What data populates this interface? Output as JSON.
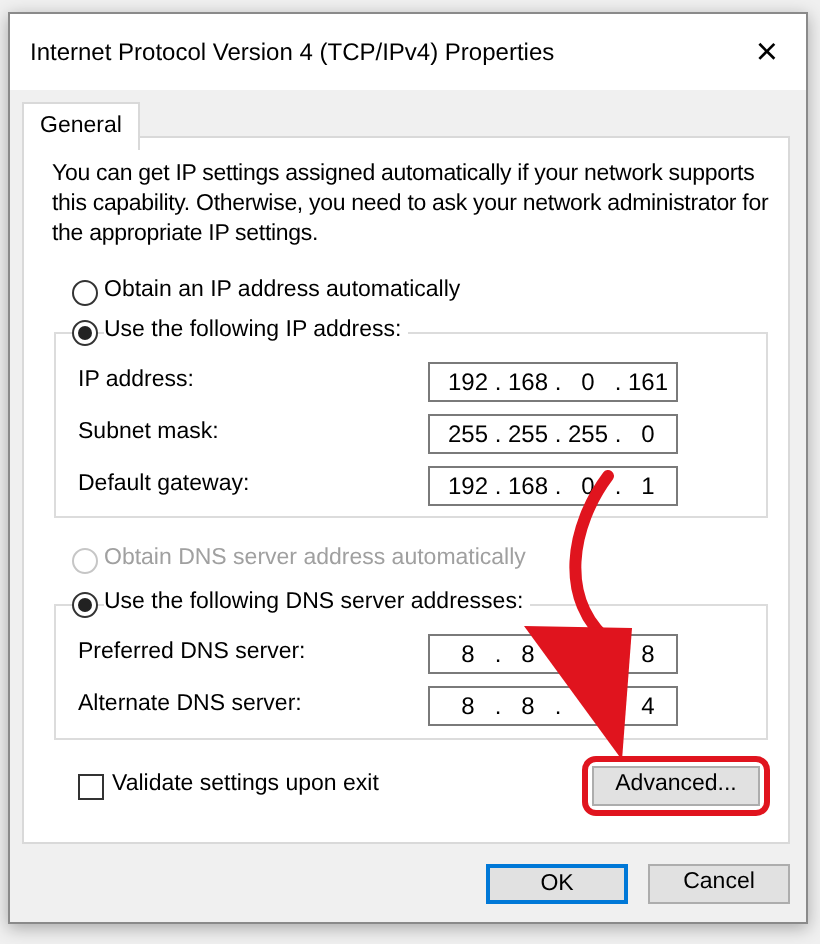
{
  "window": {
    "title": "Internet Protocol Version 4 (TCP/IPv4) Properties",
    "close": "×"
  },
  "tabs": [
    {
      "label": "General",
      "selected": true
    }
  ],
  "intro": "You can get IP settings assigned automatically if your network supports this capability. Otherwise, you need to ask your network administrator for the appropriate IP settings.",
  "ip_options": [
    {
      "label": "Obtain an IP address automatically",
      "selected": false,
      "disabled": false
    },
    {
      "label": "Use the following IP address:",
      "selected": true,
      "disabled": false
    }
  ],
  "octet_separator": ".",
  "ip_fields": [
    {
      "label": "IP address:",
      "octets": [
        "192",
        "168",
        "0",
        "161"
      ]
    },
    {
      "label": "Subnet mask:",
      "octets": [
        "255",
        "255",
        "255",
        "0"
      ]
    },
    {
      "label": "Default gateway:",
      "octets": [
        "192",
        "168",
        "0",
        "1"
      ]
    }
  ],
  "dns_options": [
    {
      "label": "Obtain DNS server address automatically",
      "selected": false,
      "disabled": true
    },
    {
      "label": "Use the following DNS server addresses:",
      "selected": true,
      "disabled": false
    }
  ],
  "dns_fields": [
    {
      "label": "Preferred DNS server:",
      "octets": [
        "8",
        "8"
      ],
      "octets_after_arrow": [
        "8"
      ]
    },
    {
      "label": "Alternate DNS server:",
      "octets": [
        "8",
        "8"
      ],
      "octets_after_arrow": [
        "4"
      ]
    }
  ],
  "validate": {
    "label": "Validate settings upon exit",
    "checked": false
  },
  "advanced": {
    "label": "Advanced...",
    "highlighted": true
  },
  "annotation_arrow": true,
  "buttons": [
    {
      "label": "OK",
      "kind": "default"
    },
    {
      "label": "Cancel",
      "kind": "normal"
    }
  ]
}
